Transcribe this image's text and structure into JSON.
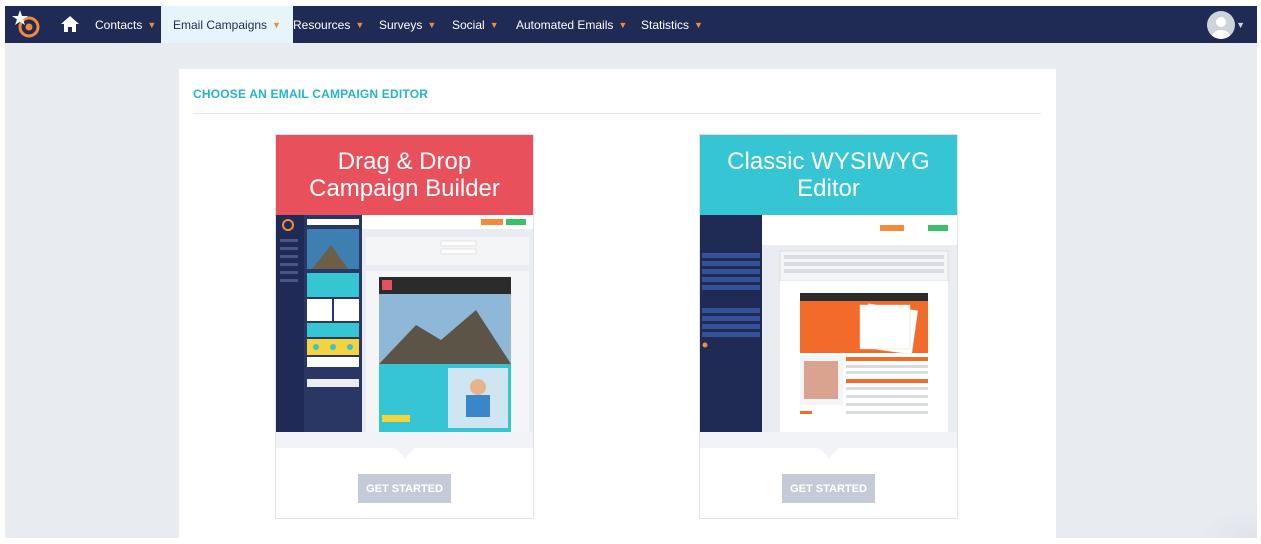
{
  "nav": {
    "items": [
      {
        "label": "Contacts"
      },
      {
        "label": "Email Campaigns"
      },
      {
        "label": "Resources"
      },
      {
        "label": "Surveys"
      },
      {
        "label": "Social"
      },
      {
        "label": "Automated Emails"
      },
      {
        "label": "Statistics"
      }
    ],
    "active": "Email Campaigns",
    "logo_icon": "starburst-target-logo",
    "home_icon": "home-icon",
    "avatar_icon": "user-avatar-icon"
  },
  "page": {
    "title": "CHOOSE AN EMAIL CAMPAIGN EDITOR"
  },
  "editors": [
    {
      "title": "Drag & Drop Campaign Builder",
      "button": "GET STARTED",
      "color": "#e8505b"
    },
    {
      "title": "Classic WYSIWYG Editor",
      "button": "GET STARTED",
      "color": "#35c5d3"
    }
  ],
  "colors": {
    "nav_bg": "#1f2a55",
    "accent_orange": "#f28c38",
    "title_teal": "#26b5c8",
    "button_grey": "#c4cbd6"
  }
}
